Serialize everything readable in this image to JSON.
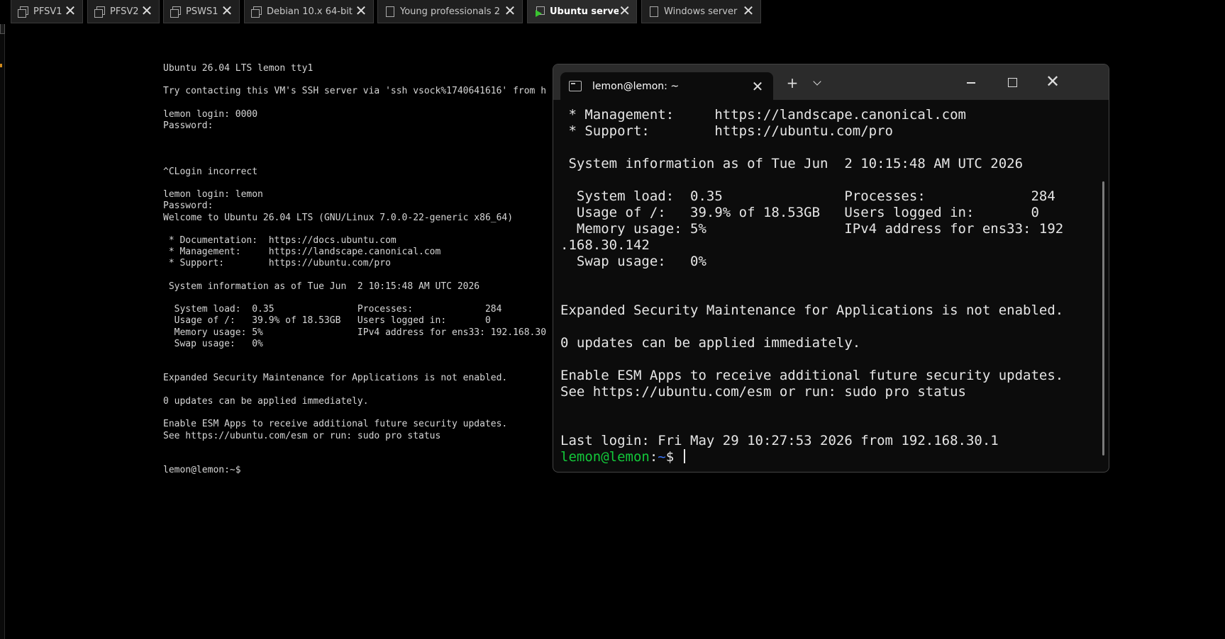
{
  "tabs": [
    {
      "label": "PFSV1",
      "icon": "vm-icon",
      "active": false
    },
    {
      "label": "PFSV2",
      "icon": "vm-icon",
      "active": false
    },
    {
      "label": "PSWS1",
      "icon": "vm-icon",
      "active": false
    },
    {
      "label": "Debian 10.x 64-bit",
      "icon": "vm-icon",
      "active": false
    },
    {
      "label": "Young professionals 2",
      "icon": "doc-icon",
      "active": false
    },
    {
      "label": "Ubuntu server",
      "icon": "vm-running-icon",
      "active": true
    },
    {
      "label": "Windows server",
      "icon": "doc-icon",
      "active": false
    }
  ],
  "close_glyph": "✕",
  "console": {
    "lines": [
      "Ubuntu 26.04 LTS lemon tty1",
      "",
      "Try contacting this VM's SSH server via 'ssh vsock%1740641616' from h",
      "",
      "lemon login: 0000",
      "Password:",
      "",
      "",
      "",
      "^CLogin incorrect",
      "",
      "lemon login: lemon",
      "Password:",
      "Welcome to Ubuntu 26.04 LTS (GNU/Linux 7.0.0-22-generic x86_64)",
      "",
      " * Documentation:  https://docs.ubuntu.com",
      " * Management:     https://landscape.canonical.com",
      " * Support:        https://ubuntu.com/pro",
      "",
      " System information as of Tue Jun  2 10:15:48 AM UTC 2026",
      "",
      "  System load:  0.35               Processes:             284",
      "  Usage of /:   39.9% of 18.53GB   Users logged in:       0",
      "  Memory usage: 5%                 IPv4 address for ens33: 192.168.30",
      "  Swap usage:   0%",
      "",
      "",
      "Expanded Security Maintenance for Applications is not enabled.",
      "",
      "0 updates can be applied immediately.",
      "",
      "Enable ESM Apps to receive additional future security updates.",
      "See https://ubuntu.com/esm or run: sudo pro status",
      "",
      "",
      "lemon@lemon:~$"
    ]
  },
  "terminal": {
    "tab_title": "lemon@lemon: ~",
    "new_tab": "+",
    "window_close": "✕",
    "lines": [
      " * Management:     https://landscape.canonical.com",
      " * Support:        https://ubuntu.com/pro",
      "",
      " System information as of Tue Jun  2 10:15:48 AM UTC 2026",
      "",
      "  System load:  0.35               Processes:             284",
      "  Usage of /:   39.9% of 18.53GB   Users logged in:       0",
      "  Memory usage: 5%                 IPv4 address for ens33: 192",
      ".168.30.142",
      "  Swap usage:   0%",
      "",
      "",
      "Expanded Security Maintenance for Applications is not enabled.",
      "",
      "0 updates can be applied immediately.",
      "",
      "Enable ESM Apps to receive additional future security updates.",
      "See https://ubuntu.com/esm or run: sudo pro status",
      "",
      "",
      "Last login: Fri May 29 10:27:53 2026 from 192.168.30.1"
    ],
    "prompt_user": "lemon@lemon",
    "prompt_colon": ":",
    "prompt_path": "~",
    "prompt_symbol": "$ "
  },
  "colors": {
    "prompt_user": "#13c83a",
    "prompt_path": "#3b78ff",
    "running_indicator": "#39c430"
  }
}
